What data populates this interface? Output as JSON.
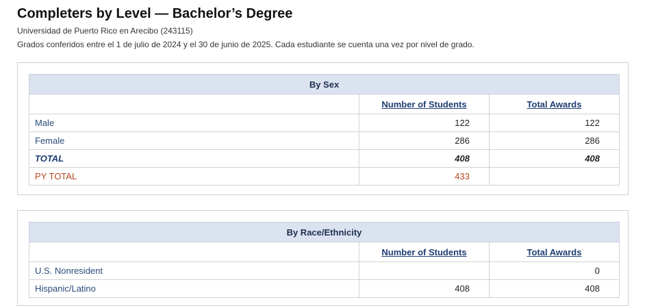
{
  "page": {
    "title": "Completers by Level — Bachelor’s Degree",
    "institution": "Universidad de Puerto Rico en Arecibo (243115)",
    "note": "Grados conferidos entre el 1 de julio de 2024 y el 30 de junio de 2025. Cada estudiante se cuenta una vez por nivel de grado."
  },
  "colors": {
    "section_header_bg": "#dbe3f1",
    "label_blue": "#2b4a7a",
    "py_total_orange": "#b3461e"
  },
  "by_sex": {
    "heading": "By Sex",
    "col_students": "Number of Students",
    "col_awards": "Total Awards",
    "rows": [
      {
        "label": "Male",
        "students": "122",
        "awards": "122"
      },
      {
        "label": "Female",
        "students": "286",
        "awards": "286"
      }
    ],
    "total": {
      "label": "TOTAL",
      "students": "408",
      "awards": "408"
    },
    "py_total": {
      "label": "PY TOTAL",
      "students": "433",
      "awards": ""
    }
  },
  "by_race": {
    "heading": "By Race/Ethnicity",
    "col_students": "Number of Students",
    "col_awards": "Total Awards",
    "rows": [
      {
        "label": "U.S. Nonresident",
        "students": "",
        "awards": "0"
      },
      {
        "label": "Hispanic/Latino",
        "students": "408",
        "awards": "408"
      }
    ]
  }
}
